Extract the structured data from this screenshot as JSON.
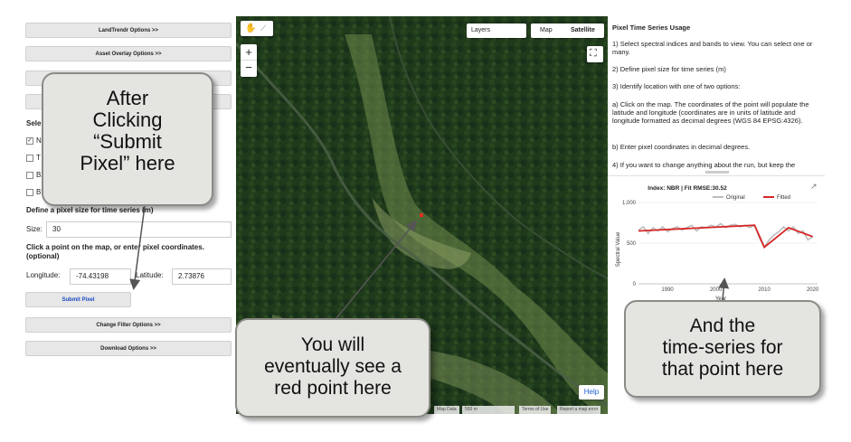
{
  "left_panel": {
    "landtrendr_button": "LandTrendr Options >>",
    "asset_overlay_button": "Asset Overlay Options >>",
    "select_heading_fragment": "Sele",
    "index_options": [
      "NI",
      "T",
      "B2",
      "B7"
    ],
    "pixel_size_heading": "Define a pixel size for time series (m)",
    "size_label": "Size:",
    "size_value": "30",
    "click_point_heading": "Click a point on the map, or enter pixel coordinates. (optional)",
    "longitude_label": "Longitude:",
    "longitude_value": "-74.43198",
    "latitude_label": "Latitude:",
    "latitude_value": "2.73876",
    "submit_pixel_button": "Submit Pixel",
    "change_filter_button": "Change Filter Options >>",
    "download_button": "Download Options >>"
  },
  "map": {
    "layers_label": "Layers",
    "map_type_map": "Map",
    "map_type_satellite": "Satellite",
    "zoom_in": "+",
    "zoom_out": "−",
    "help_button": "Help",
    "footer_mapdata": "Map Data",
    "footer_scale": "500 m",
    "footer_terms": "Terms of Use",
    "footer_report": "Report a map error"
  },
  "right_panel": {
    "title": "Pixel Time Series Usage",
    "step1": "1) Select spectral indices and bands to view. You can select one or many.",
    "step2": "2) Define pixel size for time series (m)",
    "step3": "3) Identify location with one of two options:",
    "step3a": "a) Click on the map. The coordinates of the point will populate the latitude and longitude (coordinates are in units of latitude and longitude formatted as decimal degrees (WGS 84 EPSG:4326).",
    "step3b": "b) Enter pixel coordinates in decimal degrees.",
    "step4": "4) If you want to change anything about the run, but keep the"
  },
  "chart_data": {
    "type": "line",
    "title": "Index: NBR | Fit RMSE:30.52",
    "xlabel": "Year",
    "ylabel": "Spectral Value",
    "xlim": [
      1984,
      2021
    ],
    "ylim": [
      0,
      1000
    ],
    "xticks": [
      1990,
      2000,
      2010,
      2020
    ],
    "yticks": [
      0,
      500,
      1000
    ],
    "legend_position": "top-right",
    "series": [
      {
        "name": "Original",
        "color": "#bdbdbd",
        "x": [
          1984,
          1985,
          1986,
          1987,
          1988,
          1989,
          1990,
          1991,
          1992,
          1993,
          1994,
          1995,
          1996,
          1997,
          1998,
          1999,
          2000,
          2001,
          2002,
          2003,
          2004,
          2005,
          2006,
          2007,
          2008,
          2009,
          2010,
          2011,
          2012,
          2013,
          2014,
          2015,
          2016,
          2017,
          2018,
          2019,
          2020
        ],
        "values": [
          660,
          700,
          620,
          690,
          650,
          700,
          640,
          680,
          700,
          660,
          690,
          720,
          650,
          700,
          690,
          720,
          700,
          740,
          690,
          720,
          730,
          700,
          720,
          690,
          720,
          560,
          450,
          540,
          600,
          640,
          700,
          650,
          700,
          620,
          650,
          540,
          580
        ]
      },
      {
        "name": "Fitted",
        "color": "#d62728",
        "x": [
          1984,
          2008,
          2010,
          2015,
          2020
        ],
        "values": [
          650,
          720,
          450,
          690,
          580
        ]
      }
    ]
  },
  "callouts": {
    "left_lines": [
      "After",
      "Clicking",
      "“Submit",
      "Pixel” here"
    ],
    "center_lines": [
      "You will",
      "eventually see a",
      "red point here"
    ],
    "right_lines": [
      "And the",
      "time-series for",
      "that point here"
    ]
  }
}
